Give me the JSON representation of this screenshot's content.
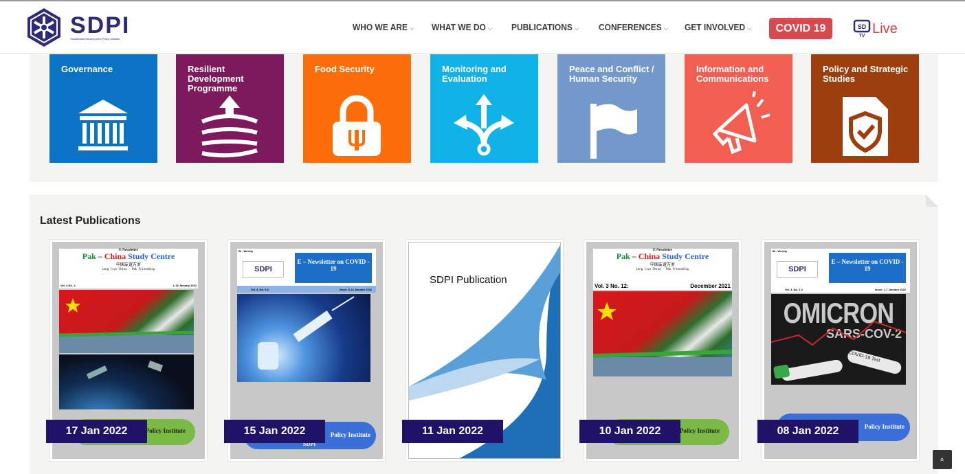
{
  "logo": {
    "name": "SDPI",
    "subtitle": "Sustainable Development Policy Institute"
  },
  "nav": {
    "items": [
      {
        "label": "WHO WE ARE"
      },
      {
        "label": "WHAT WE DO"
      },
      {
        "label": "PUBLICATIONS"
      },
      {
        "label": "CONFERENCES"
      },
      {
        "label": "GET INVOLVED"
      }
    ],
    "covid_label": "COVID 19",
    "live_label": "Live",
    "live_logo": "SDPI TV"
  },
  "themes": [
    {
      "title": "Governance",
      "color": "#0a73c4",
      "icon": "pillars-building-icon"
    },
    {
      "title": "Resilient Development Programme",
      "color": "#7c1a5c",
      "icon": "resilience-arrow-icon"
    },
    {
      "title": "Food Security",
      "color": "#fb6e09",
      "icon": "food-lock-icon"
    },
    {
      "title": "Monitoring and Evaluation",
      "color": "#0fb3e7",
      "icon": "branching-arrows-icon"
    },
    {
      "title": "Peace and Conflict / Human Security",
      "color": "#7299c9",
      "icon": "white-flag-icon"
    },
    {
      "title": "Information and Communications",
      "color": "#f25e52",
      "icon": "megaphone-icon"
    },
    {
      "title": "Policy and Strategic Studies",
      "color": "#9c3e0d",
      "icon": "shield-document-icon"
    }
  ],
  "publications": {
    "heading": "Latest Publications",
    "items": [
      {
        "date": "17 Jan 2022",
        "kind": "E-Newsletter",
        "title_a": "Pak",
        "title_b": "China",
        "title_c": "Study Centre",
        "chinese": "中国友谊万岁",
        "tagline": "Long live China - Pak Friendship",
        "vol": "Vol. 4 No. 1:",
        "issue": "1-15 January 2022",
        "footer": "Policy Institute"
      },
      {
        "date": "15 Jan 2022",
        "kind": "Bi - Weekly",
        "badge": "SDPI",
        "title": "E – Newsletter on COVID - 19",
        "vol": "Vol. 3, No. 5-6",
        "issue": "Issue: 8-14 January 2022",
        "footer": "Policy Institute",
        "footer2": "SDPI"
      },
      {
        "date": "11 Jan 2022",
        "title": "SDPI Publication"
      },
      {
        "date": "10 Jan 2022",
        "kind": "E-Newsletter",
        "title_a": "Pak",
        "title_b": "China",
        "title_c": "Study Centre",
        "chinese": "中国友谊万岁",
        "tagline": "Long live China - Pak Friendship",
        "vol": "Vol. 3 No. 12:",
        "issue": "December 2021",
        "footer": "Policy Institute"
      },
      {
        "date": "08 Jan 2022",
        "kind": "Bi - Weekly",
        "badge": "SDPI",
        "title": "E – Newsletter on COVID - 19",
        "vol": "Vol. 3, No. 1-2",
        "issue": "Issue: 1-7 January 2022",
        "hero_big": "OMICRON",
        "hero_small": "SARS-COV-2",
        "test_label": "COVID-19 Test",
        "footer": "Policy Institute"
      }
    ]
  },
  "scroll_top": "»"
}
